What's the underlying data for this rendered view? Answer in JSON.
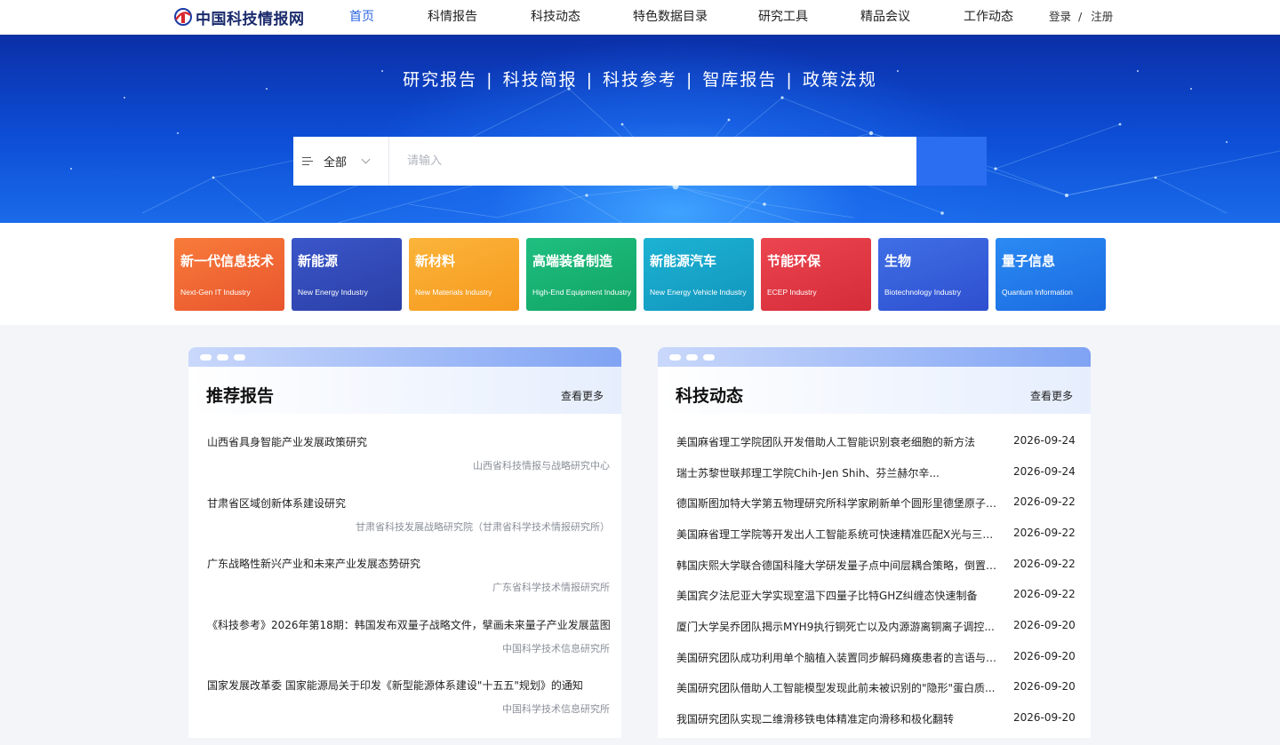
{
  "header": {
    "logo_text": "中国科技情报网",
    "nav": [
      "首页",
      "科情报告",
      "科技动态",
      "特色数据目录",
      "研究工具",
      "精品会议",
      "工作动态"
    ],
    "login": "登录",
    "auth_sep": "/",
    "register": "注册"
  },
  "banner": {
    "links": [
      "研究报告",
      "科技简报",
      "科技参考",
      "智库报告",
      "政策法规"
    ],
    "separator": "|",
    "search_scope": "全部",
    "search_placeholder": "请输入"
  },
  "categories": [
    {
      "title": "新一代信息技术",
      "en": "Next-Gen IT Industry",
      "color_from": "#f87b3a",
      "color_to": "#e8552e"
    },
    {
      "title": "新能源",
      "en": "New Energy Industry",
      "color_from": "#3a56c9",
      "color_to": "#2b3fa6"
    },
    {
      "title": "新材料",
      "en": "New Materials Industry",
      "color_from": "#fbb43a",
      "color_to": "#f69a1f"
    },
    {
      "title": "高端装备制造",
      "en": "High-End Equipment Industry",
      "color_from": "#1fbf80",
      "color_to": "#11a465"
    },
    {
      "title": "新能源汽车",
      "en": "New Energy Vehicle Industry",
      "color_from": "#1cb2d3",
      "color_to": "#1296bd"
    },
    {
      "title": "节能环保",
      "en": "ECEP Industry",
      "color_from": "#ec4550",
      "color_to": "#d42c38"
    },
    {
      "title": "生物",
      "en": "Biotechnology Industry",
      "color_from": "#3f6fe6",
      "color_to": "#2e4fcf"
    },
    {
      "title": "量子信息",
      "en": "Quantum Information",
      "color_from": "#2b8af3",
      "color_to": "#1a6be0"
    }
  ],
  "reports_panel": {
    "title": "推荐报告",
    "more": "查看更多",
    "items": [
      {
        "title": "山西省具身智能产业发展政策研究",
        "source": "山西省科技情报与战略研究中心"
      },
      {
        "title": "甘肃省区域创新体系建设研究",
        "source": "甘肃省科技发展战略研究院（甘肃省科学技术情报研究所）"
      },
      {
        "title": "广东战略性新兴产业和未来产业发展态势研究",
        "source": "广东省科学技术情报研究所"
      },
      {
        "title": "《科技参考》2026年第18期：韩国发布双量子战略文件，擘画未来量子产业发展蓝图",
        "source": "中国科学技术信息研究所"
      },
      {
        "title": "国家发展改革委 国家能源局关于印发《新型能源体系建设\"十五五\"规划》的通知",
        "source": "中国科学技术信息研究所"
      }
    ]
  },
  "news_panel": {
    "title": "科技动态",
    "more": "查看更多",
    "items": [
      {
        "title": "美国麻省理工学院团队开发借助人工智能识别衰老细胞的新方法",
        "date": "2026-09-24"
      },
      {
        "title": "瑞士苏黎世联邦理工学院Chih-Jen Shih、芬兰赫尔辛...",
        "date": "2026-09-24"
      },
      {
        "title": "德国斯图加特大学第五物理研究所科学家刷新单个圆形里德堡原子多...",
        "date": "2026-09-22"
      },
      {
        "title": "美国麻省理工学院等开发出人工智能系统可快速精准匹配X光与三维...",
        "date": "2026-09-22"
      },
      {
        "title": "韩国庆熙大学联合德国科隆大学研发量子点中间层耦合策略，倒置磷...",
        "date": "2026-09-22"
      },
      {
        "title": "美国宾夕法尼亚大学实现室温下四量子比特GHZ纠缠态快速制备",
        "date": "2026-09-22"
      },
      {
        "title": "厦门大学吴乔团队揭示MYH9执行铜死亡以及内源游离铜离子调控...",
        "date": "2026-09-20"
      },
      {
        "title": "美国研究团队成功利用单个脑植入装置同步解码瘫痪患者的言语与手...",
        "date": "2026-09-20"
      },
      {
        "title": "美国研究团队借助人工智能模型发现此前未被识别的\"隐形\"蛋白质...",
        "date": "2026-09-20"
      },
      {
        "title": "我国研究团队实现二维滑移铁电体精准定向滑移和极化翻转",
        "date": "2026-09-20"
      }
    ]
  },
  "colors": {
    "accent": "#2b64e3",
    "search_button": "#2b6ef2"
  }
}
